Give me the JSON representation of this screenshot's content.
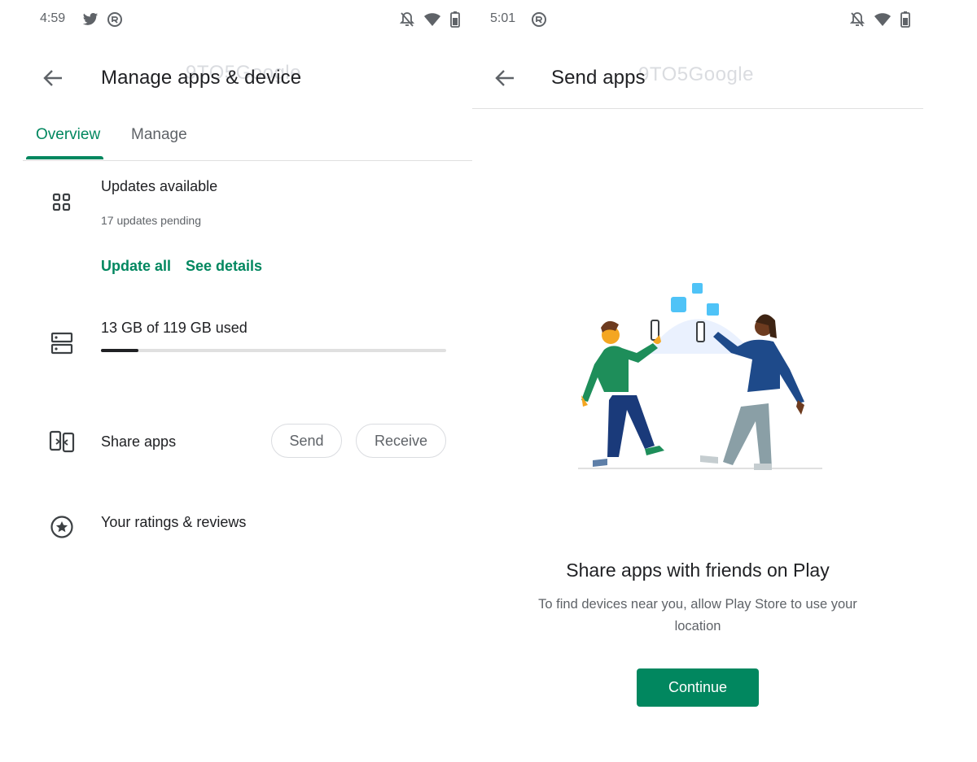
{
  "left": {
    "status_bar": {
      "time": "4:59"
    },
    "app_bar": {
      "title": "Manage apps & device",
      "watermark": "9TO5Google"
    },
    "tabs": [
      {
        "label": "Overview",
        "active": true
      },
      {
        "label": "Manage",
        "active": false
      }
    ],
    "updates": {
      "title": "Updates available",
      "subtitle": "17 updates pending",
      "update_all_label": "Update all",
      "see_details_label": "See details"
    },
    "storage": {
      "text": "13 GB of 119 GB used",
      "used_gb": 13,
      "total_gb": 119
    },
    "share": {
      "label": "Share apps",
      "send_label": "Send",
      "receive_label": "Receive"
    },
    "ratings": {
      "label": "Your ratings & reviews"
    }
  },
  "right": {
    "status_bar": {
      "time": "5:01"
    },
    "app_bar": {
      "title": "Send apps",
      "watermark": "9TO5Google"
    },
    "heading": "Share apps with friends on Play",
    "description": "To find devices near you, allow Play Store to use your location",
    "continue_label": "Continue"
  },
  "colors": {
    "accent": "#01875f",
    "text_primary": "#202124",
    "text_secondary": "#5f6368",
    "divider": "#e0e0e0"
  },
  "icons": {
    "status": [
      "twitter-icon",
      "sync-icon",
      "notifications-off-icon",
      "wifi-icon",
      "battery-icon"
    ],
    "rows": [
      "apps-grid-icon",
      "storage-icon",
      "share-devices-icon",
      "star-circle-icon"
    ],
    "nav": "arrow-back-icon"
  }
}
